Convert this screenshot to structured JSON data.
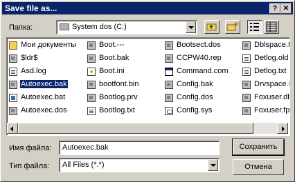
{
  "window": {
    "title": "Save file as..."
  },
  "titlebar": {
    "help": "?",
    "close": "✕"
  },
  "location": {
    "label": "Папка:",
    "value": "System dos (C:)"
  },
  "files": [
    {
      "name": "Мои документы",
      "icon": "folder-icon"
    },
    {
      "name": "$ldr$",
      "icon": "system-file-icon"
    },
    {
      "name": "Asd.log",
      "icon": "text-file-icon"
    },
    {
      "name": "Autoexec.bak",
      "icon": "system-file-icon"
    },
    {
      "name": "Autoexec.bat",
      "icon": "batch-file-icon"
    },
    {
      "name": "Autoexec.dos",
      "icon": "system-file-icon"
    },
    {
      "name": "Boot.---",
      "icon": "system-file-icon"
    },
    {
      "name": "Boot.bak",
      "icon": "system-file-icon"
    },
    {
      "name": "Boot.ini",
      "icon": "ini-file-icon"
    },
    {
      "name": "bootfont.bin",
      "icon": "system-file-icon"
    },
    {
      "name": "Bootlog.prv",
      "icon": "system-file-icon"
    },
    {
      "name": "Bootlog.txt",
      "icon": "text-file-icon"
    },
    {
      "name": "Bootsect.dos",
      "icon": "system-file-icon"
    },
    {
      "name": "CCPW40.rep",
      "icon": "system-file-icon"
    },
    {
      "name": "Command.com",
      "icon": "application-icon"
    },
    {
      "name": "Config.bak",
      "icon": "system-file-icon"
    },
    {
      "name": "Config.dos",
      "icon": "system-file-icon"
    },
    {
      "name": "Config.sys",
      "icon": "config-file-icon"
    },
    {
      "name": "Dblspace.I",
      "icon": "system-file-icon"
    },
    {
      "name": "Detlog.old",
      "icon": "text-file-icon"
    },
    {
      "name": "Detlog.txt",
      "icon": "text-file-icon"
    },
    {
      "name": "Drvspace.I",
      "icon": "system-file-icon"
    },
    {
      "name": "Foxuser.db",
      "icon": "system-file-icon"
    },
    {
      "name": "Foxuser.fp",
      "icon": "system-file-icon"
    }
  ],
  "selected_file": "Autoexec.bak",
  "filename": {
    "label": "Имя файла:",
    "value": "Autoexec.bak"
  },
  "filetype": {
    "label": "Тип файла:",
    "value": "All Files (*.*)"
  },
  "buttons": {
    "save": "Сохранить",
    "cancel": "Отмена"
  }
}
